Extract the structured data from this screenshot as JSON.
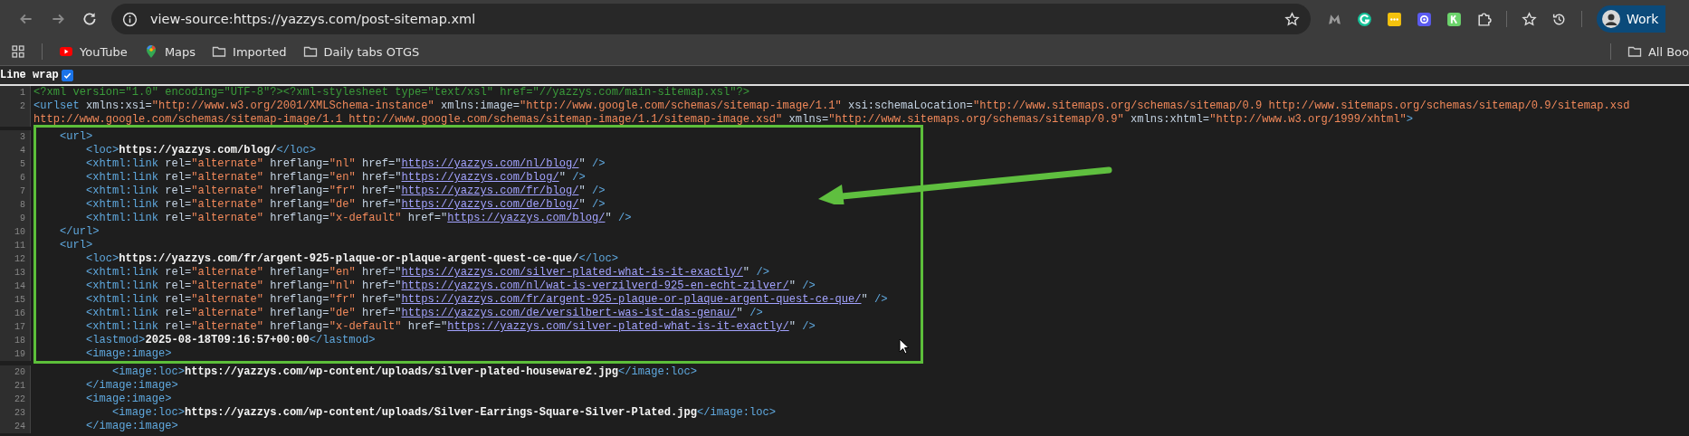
{
  "toolbar": {
    "address": "view-source:https://yazzys.com/post-sitemap.xml",
    "profile": "Work"
  },
  "bookmarks": [
    {
      "kind": "youtube",
      "label": "YouTube"
    },
    {
      "kind": "maps",
      "label": "Maps"
    },
    {
      "kind": "folder",
      "label": "Imported"
    },
    {
      "kind": "folder",
      "label": "Daily tabs OTGS"
    }
  ],
  "all_bookmarks": "All Boo",
  "line_wrap": {
    "label": "Line wrap",
    "checked": true
  },
  "lines": [
    {
      "number": "1",
      "segments": [
        {
          "kind": "pi",
          "text": "<?xml version=\"1.0\" encoding=\"UTF-8\"?><?xml-stylesheet type=\"text/xsl\" href=\"//yazzys.com/main-sitemap.xsl\"?>"
        }
      ]
    },
    {
      "number": "2",
      "segments": [
        {
          "kind": "tag",
          "text": "<urlset"
        },
        {
          "kind": "attr",
          "text": " xmlns:xsi="
        },
        {
          "kind": "value",
          "text": "\"http://www.w3.org/2001/XMLSchema-instance\""
        },
        {
          "kind": "attr",
          "text": " xmlns:image="
        },
        {
          "kind": "value",
          "text": "\"http://www.google.com/schemas/sitemap-image/1.1\""
        },
        {
          "kind": "attr",
          "text": " xsi:schemaLocation="
        },
        {
          "kind": "value",
          "text": "\"http://www.sitemaps.org/schemas/sitemap/0.9 http://www.sitemaps.org/schemas/sitemap/0.9/sitemap.xsd http://www.google.com/schemas/sitemap-image/1.1 http://www.google.com/schemas/sitemap-image/1.1/sitemap-image.xsd\""
        },
        {
          "kind": "attr",
          "text": " xmlns="
        },
        {
          "kind": "value",
          "text": "\"http://www.sitemaps.org/schemas/sitemap/0.9\""
        },
        {
          "kind": "attr",
          "text": " xmlns:xhtml="
        },
        {
          "kind": "value",
          "text": "\"http://www.w3.org/1999/xhtml\""
        },
        {
          "kind": "tag",
          "text": ">"
        }
      ]
    },
    {
      "number": "3",
      "segments": [
        {
          "kind": "tag",
          "text": "    <url>"
        }
      ]
    },
    {
      "number": "4",
      "segments": [
        {
          "kind": "tag",
          "text": "        <loc>"
        },
        {
          "kind": "text",
          "text": "https://yazzys.com/blog/"
        },
        {
          "kind": "tag",
          "text": "</loc>"
        }
      ]
    },
    {
      "number": "5",
      "segments": [
        {
          "kind": "tag",
          "text": "        <xhtml:link"
        },
        {
          "kind": "attr",
          "text": " rel="
        },
        {
          "kind": "value",
          "text": "\"alternate\""
        },
        {
          "kind": "attr",
          "text": " hreflang="
        },
        {
          "kind": "value",
          "text": "\"nl\""
        },
        {
          "kind": "attr",
          "text": " href=\""
        },
        {
          "kind": "link",
          "text": "https://yazzys.com/nl/blog/"
        },
        {
          "kind": "attr",
          "text": "\""
        },
        {
          "kind": "tag",
          "text": " />"
        }
      ]
    },
    {
      "number": "6",
      "segments": [
        {
          "kind": "tag",
          "text": "        <xhtml:link"
        },
        {
          "kind": "attr",
          "text": " rel="
        },
        {
          "kind": "value",
          "text": "\"alternate\""
        },
        {
          "kind": "attr",
          "text": " hreflang="
        },
        {
          "kind": "value",
          "text": "\"en\""
        },
        {
          "kind": "attr",
          "text": " href=\""
        },
        {
          "kind": "link",
          "text": "https://yazzys.com/blog/"
        },
        {
          "kind": "attr",
          "text": "\""
        },
        {
          "kind": "tag",
          "text": " />"
        }
      ]
    },
    {
      "number": "7",
      "segments": [
        {
          "kind": "tag",
          "text": "        <xhtml:link"
        },
        {
          "kind": "attr",
          "text": " rel="
        },
        {
          "kind": "value",
          "text": "\"alternate\""
        },
        {
          "kind": "attr",
          "text": " hreflang="
        },
        {
          "kind": "value",
          "text": "\"fr\""
        },
        {
          "kind": "attr",
          "text": " href=\""
        },
        {
          "kind": "link",
          "text": "https://yazzys.com/fr/blog/"
        },
        {
          "kind": "attr",
          "text": "\""
        },
        {
          "kind": "tag",
          "text": " />"
        }
      ]
    },
    {
      "number": "8",
      "segments": [
        {
          "kind": "tag",
          "text": "        <xhtml:link"
        },
        {
          "kind": "attr",
          "text": " rel="
        },
        {
          "kind": "value",
          "text": "\"alternate\""
        },
        {
          "kind": "attr",
          "text": " hreflang="
        },
        {
          "kind": "value",
          "text": "\"de\""
        },
        {
          "kind": "attr",
          "text": " href=\""
        },
        {
          "kind": "link",
          "text": "https://yazzys.com/de/blog/"
        },
        {
          "kind": "attr",
          "text": "\""
        },
        {
          "kind": "tag",
          "text": " />"
        }
      ]
    },
    {
      "number": "9",
      "segments": [
        {
          "kind": "tag",
          "text": "        <xhtml:link"
        },
        {
          "kind": "attr",
          "text": " rel="
        },
        {
          "kind": "value",
          "text": "\"alternate\""
        },
        {
          "kind": "attr",
          "text": " hreflang="
        },
        {
          "kind": "value",
          "text": "\"x-default\""
        },
        {
          "kind": "attr",
          "text": " href=\""
        },
        {
          "kind": "link",
          "text": "https://yazzys.com/blog/"
        },
        {
          "kind": "attr",
          "text": "\""
        },
        {
          "kind": "tag",
          "text": " />"
        }
      ]
    },
    {
      "number": "10",
      "segments": [
        {
          "kind": "tag",
          "text": "    </url>"
        }
      ]
    },
    {
      "number": "11",
      "segments": [
        {
          "kind": "tag",
          "text": "    <url>"
        }
      ]
    },
    {
      "number": "12",
      "segments": [
        {
          "kind": "tag",
          "text": "        <loc>"
        },
        {
          "kind": "text",
          "text": "https://yazzys.com/fr/argent-925-plaque-or-plaque-argent-quest-ce-que/"
        },
        {
          "kind": "tag",
          "text": "</loc>"
        }
      ]
    },
    {
      "number": "13",
      "segments": [
        {
          "kind": "tag",
          "text": "        <xhtml:link"
        },
        {
          "kind": "attr",
          "text": " rel="
        },
        {
          "kind": "value",
          "text": "\"alternate\""
        },
        {
          "kind": "attr",
          "text": " hreflang="
        },
        {
          "kind": "value",
          "text": "\"en\""
        },
        {
          "kind": "attr",
          "text": " href=\""
        },
        {
          "kind": "link",
          "text": "https://yazzys.com/silver-plated-what-is-it-exactly/"
        },
        {
          "kind": "attr",
          "text": "\""
        },
        {
          "kind": "tag",
          "text": " />"
        }
      ]
    },
    {
      "number": "14",
      "segments": [
        {
          "kind": "tag",
          "text": "        <xhtml:link"
        },
        {
          "kind": "attr",
          "text": " rel="
        },
        {
          "kind": "value",
          "text": "\"alternate\""
        },
        {
          "kind": "attr",
          "text": " hreflang="
        },
        {
          "kind": "value",
          "text": "\"nl\""
        },
        {
          "kind": "attr",
          "text": " href=\""
        },
        {
          "kind": "link",
          "text": "https://yazzys.com/nl/wat-is-verzilverd-925-en-echt-zilver/"
        },
        {
          "kind": "attr",
          "text": "\""
        },
        {
          "kind": "tag",
          "text": " />"
        }
      ]
    },
    {
      "number": "15",
      "segments": [
        {
          "kind": "tag",
          "text": "        <xhtml:link"
        },
        {
          "kind": "attr",
          "text": " rel="
        },
        {
          "kind": "value",
          "text": "\"alternate\""
        },
        {
          "kind": "attr",
          "text": " hreflang="
        },
        {
          "kind": "value",
          "text": "\"fr\""
        },
        {
          "kind": "attr",
          "text": " href=\""
        },
        {
          "kind": "link",
          "text": "https://yazzys.com/fr/argent-925-plaque-or-plaque-argent-quest-ce-que/"
        },
        {
          "kind": "attr",
          "text": "\""
        },
        {
          "kind": "tag",
          "text": " />"
        }
      ]
    },
    {
      "number": "16",
      "segments": [
        {
          "kind": "tag",
          "text": "        <xhtml:link"
        },
        {
          "kind": "attr",
          "text": " rel="
        },
        {
          "kind": "value",
          "text": "\"alternate\""
        },
        {
          "kind": "attr",
          "text": " hreflang="
        },
        {
          "kind": "value",
          "text": "\"de\""
        },
        {
          "kind": "attr",
          "text": " href=\""
        },
        {
          "kind": "link",
          "text": "https://yazzys.com/de/versilbert-was-ist-das-genau/"
        },
        {
          "kind": "attr",
          "text": "\""
        },
        {
          "kind": "tag",
          "text": " />"
        }
      ]
    },
    {
      "number": "17",
      "segments": [
        {
          "kind": "tag",
          "text": "        <xhtml:link"
        },
        {
          "kind": "attr",
          "text": " rel="
        },
        {
          "kind": "value",
          "text": "\"alternate\""
        },
        {
          "kind": "attr",
          "text": " hreflang="
        },
        {
          "kind": "value",
          "text": "\"x-default\""
        },
        {
          "kind": "attr",
          "text": " href=\""
        },
        {
          "kind": "link",
          "text": "https://yazzys.com/silver-plated-what-is-it-exactly/"
        },
        {
          "kind": "attr",
          "text": "\""
        },
        {
          "kind": "tag",
          "text": " />"
        }
      ]
    },
    {
      "number": "18",
      "segments": [
        {
          "kind": "tag",
          "text": "        <lastmod>"
        },
        {
          "kind": "text",
          "text": "2025-08-18T09:16:57+00:00"
        },
        {
          "kind": "tag",
          "text": "</lastmod>"
        }
      ]
    },
    {
      "number": "19",
      "segments": [
        {
          "kind": "tag",
          "text": "        <image:image>"
        }
      ]
    },
    {
      "number": "20",
      "segments": [
        {
          "kind": "tag",
          "text": "            <image:loc>"
        },
        {
          "kind": "text",
          "text": "https://yazzys.com/wp-content/uploads/silver-plated-houseware2.jpg"
        },
        {
          "kind": "tag",
          "text": "</image:loc>"
        }
      ]
    },
    {
      "number": "21",
      "segments": [
        {
          "kind": "tag",
          "text": "        </image:image>"
        }
      ]
    },
    {
      "number": "22",
      "segments": [
        {
          "kind": "tag",
          "text": "        <image:image>"
        }
      ]
    },
    {
      "number": "23",
      "segments": [
        {
          "kind": "tag",
          "text": "            <image:loc>"
        },
        {
          "kind": "text",
          "text": "https://yazzys.com/wp-content/uploads/Silver-Earrings-Square-Silver-Plated.jpg"
        },
        {
          "kind": "tag",
          "text": "</image:loc>"
        }
      ]
    },
    {
      "number": "24",
      "segments": [
        {
          "kind": "tag",
          "text": "        </image:image>"
        }
      ]
    }
  ]
}
